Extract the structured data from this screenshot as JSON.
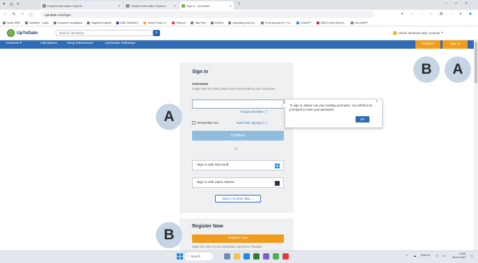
{
  "browser": {
    "tabs": [
      {
        "title": "Hospital Information System",
        "active": false
      },
      {
        "title": "Hospital Information System",
        "active": false
      },
      {
        "title": "Sign in - UpToDate",
        "active": true
      }
    ],
    "new_tab_label": "+",
    "window_controls": [
      "–",
      "□",
      "✕"
    ],
    "address": "uptodate.com/login",
    "bookmarks": [
      "Quick SMS",
      "Sandesh · Login",
      "Cassandr Sandakpur",
      "Sagrika Endpoint",
      "B2B TATAAIGY",
      "Yellow Track 1.1",
      "Telecom",
      "Tata Play",
      "KURLA",
      "Uploading And Do...",
      "Fund Assurance Y N...",
      "ChatGPT",
      "(1667) CHAI Merna...",
      "Sub WAPP"
    ]
  },
  "site": {
    "logo_text": "UpToDate",
    "search_placeholder": "Search UpToDate",
    "hospital_name": "Vikash Multispeciality Hospital",
    "nav": [
      "Contents",
      "Calculators",
      "Drug Interactions",
      "UpToDate Pathways"
    ],
    "register_label": "Register",
    "signin_label": "Sign in"
  },
  "signin": {
    "title": "Sign in",
    "username_label": "Username",
    "username_help": "Single Sign-On (SSO) users enter your Email as your Username.",
    "forgot_username": "Forgot username",
    "remember_me": "Remember me",
    "need_help": "Need help signing in",
    "continue_label": "Continue",
    "or_label": "or",
    "microsoft_label": "Sign in with Microsoft",
    "athens_label": "Sign in with Open Athens",
    "another_way": "Sign in Another Way"
  },
  "tooltip": {
    "text": "To sign in, please use your existing username. You will then be prompted to enter your password.",
    "ok_label": "OK",
    "close": "×"
  },
  "register": {
    "title": "Register Now",
    "button_label": "Register Now",
    "text": "Make the most of your UpToDate experience: Register"
  },
  "badges": {
    "b_top": "B",
    "a_top": "A",
    "a_mid": "A",
    "b_bottom": "B"
  },
  "taskbar": {
    "search_label": "Search",
    "lang": "ENG IN",
    "time": "19:59",
    "date": "28-01-2024"
  },
  "colors": {
    "nav_blue": "#2f6cb5",
    "orange": "#f19c1c",
    "continue_blue": "#8ebde0",
    "badge_fill": "#c6d5e6"
  }
}
